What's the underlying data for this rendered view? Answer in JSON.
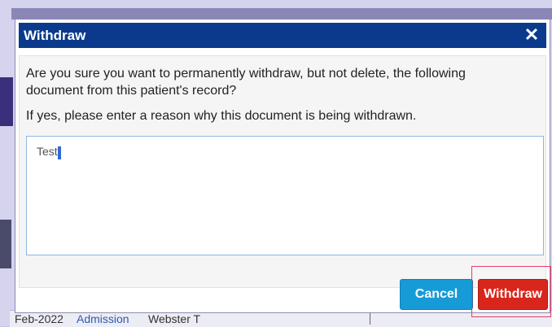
{
  "dialog": {
    "title": "Withdraw",
    "close_icon": "close-icon",
    "message": "Are you sure you want to permanently withdraw, but not delete, the following document from this patient's record?",
    "prompt": "If yes, please enter a reason why this document is being withdrawn.",
    "reason_value": "Test",
    "cancel_label": "Cancel",
    "withdraw_label": "Withdraw"
  },
  "background_row": {
    "date": "Feb-2022",
    "type": "Admission",
    "name": "Webster T"
  },
  "colors": {
    "titlebar": "#0b3a8c",
    "cancel": "#179bd7",
    "withdraw": "#d9261c",
    "highlight": "#e23d6b"
  }
}
